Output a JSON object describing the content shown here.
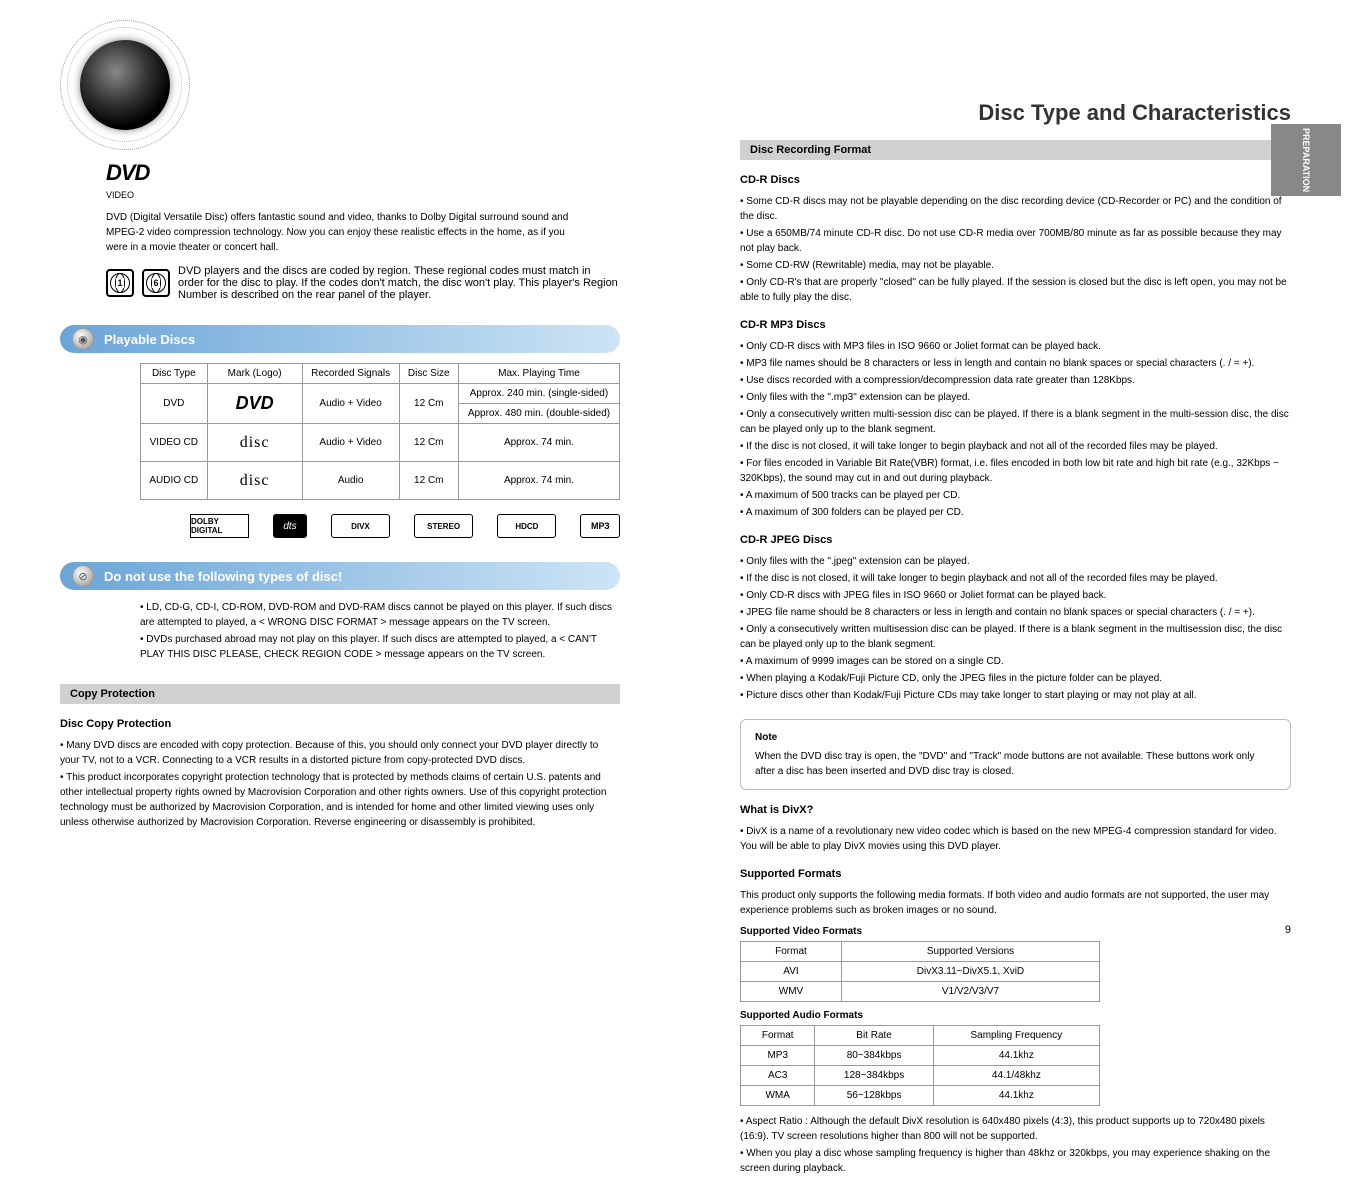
{
  "pageTitle": "Disc Type and Characteristics",
  "sideTab": "PREPARATION",
  "dvdLogo": {
    "top": "DVD",
    "sub": "VIDEO"
  },
  "header": {
    "dvdDesc": "DVD (Digital Versatile Disc) offers fantastic sound and video, thanks to Dolby Digital surround sound and MPEG-2 video compression technology. Now you can enjoy these realistic effects in the home, as if you were in a movie theater or concert hall.",
    "regionNums": {
      "a": "1",
      "b": "6"
    },
    "regionText": "DVD players and the discs are coded by region. These regional codes must match in order for the disc to play. If the codes don't match, the disc won't play. This player's Region Number is described on the rear panel of the player."
  },
  "playable": {
    "title": "Playable Discs",
    "headers": {
      "type": "Disc Type",
      "mark": "Mark (Logo)",
      "signals": "Recorded Signals",
      "size": "Disc Size",
      "time": "Max. Playing Time"
    },
    "rows": [
      {
        "type": "DVD",
        "signals": "Audio + Video",
        "size": "12 Cm",
        "timeA": "Approx. 240 min. (single-sided)",
        "timeB": "Approx. 480 min. (double-sided)"
      },
      {
        "type": "VIDEO CD",
        "signals": "Audio + Video",
        "size": "12 Cm",
        "timeA": "Approx. 74 min.",
        "timeB": ""
      },
      {
        "type": "AUDIO CD",
        "signals": "Audio",
        "size": "12 Cm",
        "timeA": "Approx. 74 min.",
        "timeB": ""
      }
    ],
    "codecs": {
      "dolby": "DOLBY DIGITAL",
      "dts": "dts",
      "divx": "DIVX",
      "stereo": "STEREO",
      "hdcd": "HDCD",
      "mp3": "MP3"
    }
  },
  "unplayable": {
    "title": "Do not use the following types of disc!",
    "items": [
      "LD, CD-G, CD-I, CD-ROM, DVD-ROM and DVD-RAM discs cannot be played on this player. If such discs are attempted to played, a < WRONG DISC FORMAT > message appears on the TV screen.",
      "DVDs purchased abroad may not play on this player. If such discs are attempted to played, a < CAN'T PLAY THIS DISC PLEASE, CHECK REGION CODE > message appears on the TV screen."
    ]
  },
  "copyProtection": {
    "bar": "Copy Protection",
    "heading": "Disc Copy Protection",
    "items": [
      "Many DVD discs are encoded with copy protection. Because of this, you should only connect your DVD player directly to your TV, not to a VCR. Connecting to a VCR results in a distorted picture from copy-protected DVD discs.",
      "This product incorporates copyright protection technology that is protected by methods claims of certain U.S. patents and other intellectual property rights owned by Macrovision Corporation and other rights owners. Use of this copyright protection technology must be authorized by Macrovision Corporation, and is intended for home and other limited viewing uses only unless otherwise authorized by Macrovision Corporation. Reverse engineering or disassembly is prohibited."
    ]
  },
  "rightCol": {
    "recordingBar": "Disc Recording Format",
    "cdr": {
      "title": "CD-R Discs",
      "items": [
        "Some CD-R discs may not be playable depending on the disc recording device (CD-Recorder or PC) and the condition of the disc.",
        "Use a 650MB/74 minute CD-R disc. Do not use CD-R media over 700MB/80 minute as far as possible because they may not play back.",
        "Some CD-RW (Rewritable) media, may not be playable.",
        "Only CD-R's that are properly \"closed\" can be fully played. If the session is closed but the disc is left open, you may not be able to fully play the disc."
      ]
    },
    "mp3": {
      "title": "CD-R MP3 Discs",
      "items": [
        "Only CD-R discs with MP3 files in ISO 9660 or Joliet format can be played back.",
        "MP3 file names should be 8 characters or less in length and contain no blank spaces or special characters (. / = +).",
        "Use discs recorded with a compression/decompression data rate greater than 128Kbps.",
        "Only files with the \".mp3\" extension can be played.",
        "Only a consecutively written multi-session disc can be played. If there is a blank segment in the multi-session disc, the disc can be played only up to the blank segment.",
        "If the disc is not closed, it will take longer to begin playback and not all of the recorded files may be played.",
        "For files encoded in Variable Bit Rate(VBR) format, i.e. files encoded in both low bit rate and high bit rate (e.g., 32Kbps ~ 320Kbps), the sound may cut in and out during playback.",
        "A maximum of 500 tracks can be played per CD.",
        "A maximum of 300 folders can be played per CD."
      ]
    },
    "jpeg": {
      "title": "CD-R JPEG Discs",
      "items": [
        "Only files with the \".jpeg\" extension can be played.",
        "If the disc is not closed, it will take longer to begin playback and not all of the recorded files may be played.",
        "Only CD-R discs with JPEG files in ISO 9660 or Joliet format can be played back.",
        "JPEG file name should be 8 characters or less in length and contain no blank spaces or special characters (. / = +).",
        "Only a consecutively written multisession disc can be played. If there is a blank segment in the multisession disc, the disc can be played only up to the blank segment.",
        "A maximum of 9999 images can be stored on a single CD.",
        "When playing a Kodak/Fuji Picture CD, only the JPEG files in the picture folder can be played.",
        "Picture discs other than Kodak/Fuji Picture CDs may take longer to start playing or may not play at all."
      ]
    },
    "note": {
      "title": "Note",
      "text": "When the DVD disc tray is open, the \"DVD\" and \"Track\" mode buttons are not available. These buttons work only after a disc has been inserted and DVD disc tray is closed."
    },
    "divx": {
      "title": "What is DivX?",
      "items": [
        "DivX is a name of a revolutionary new video codec which is based on the new MPEG-4 compression standard for video. You will be able to play DivX movies using this DVD player."
      ]
    },
    "supported": {
      "title": "Supported Formats",
      "intro": "This product only supports the following media formats. If both video and audio formats are not supported, the user may experience problems such as broken images or no sound.",
      "video": {
        "title": "Supported Video Formats",
        "headers": {
          "format": "Format",
          "versions": "Supported Versions"
        },
        "rows": [
          {
            "format": "AVI",
            "versions": "DivX3.11~DivX5.1, XviD"
          },
          {
            "format": "WMV",
            "versions": "V1/V2/V3/V7"
          }
        ]
      },
      "audio": {
        "title": "Supported Audio Formats",
        "headers": {
          "format": "Format",
          "bitrate": "Bit Rate",
          "freq": "Sampling Frequency"
        },
        "rows": [
          {
            "format": "MP3",
            "bitrate": "80~384kbps",
            "freq": "44.1khz"
          },
          {
            "format": "AC3",
            "bitrate": "128~384kbps",
            "freq": "44.1/48khz"
          },
          {
            "format": "WMA",
            "bitrate": "56~128kbps",
            "freq": "44.1khz"
          }
        ]
      },
      "notes": [
        "Aspect Ratio : Although the default DivX resolution is 640x480 pixels (4:3), this product supports up to 720x480 pixels (16:9). TV screen resolutions higher than 800 will not be supported.",
        "When you play a disc whose sampling frequency is higher than 48khz or 320kbps, you may experience shaking on the screen during playback."
      ]
    }
  },
  "pageNum": "9"
}
